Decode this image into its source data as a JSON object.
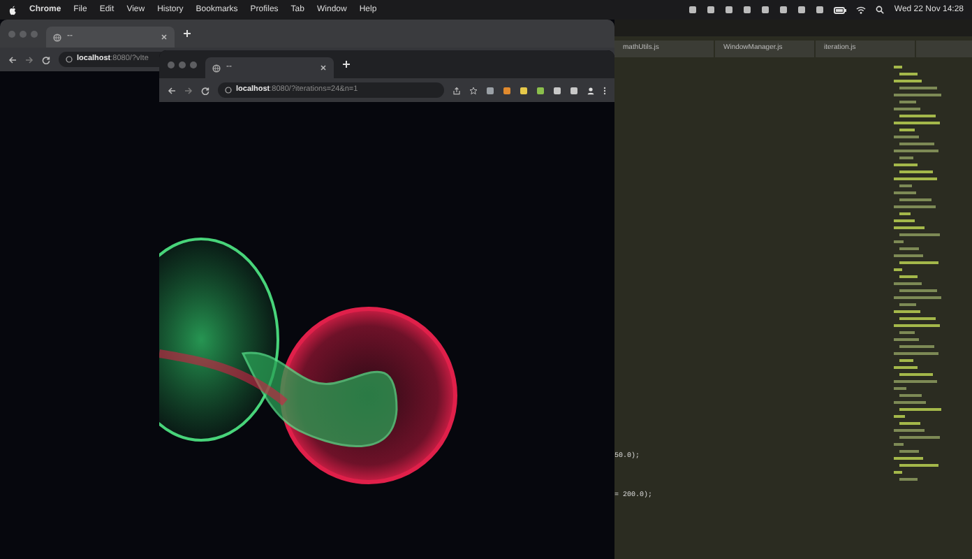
{
  "menu_bar": {
    "app": "Chrome",
    "menus": [
      "File",
      "Edit",
      "View",
      "History",
      "Bookmarks",
      "Profiles",
      "Tab",
      "Window",
      "Help"
    ],
    "clock": "Wed 22 Nov 14:28"
  },
  "back_browser": {
    "tabs": [
      {
        "title": "--",
        "selected": true
      }
    ],
    "url_host": "localhost",
    "url_rest": ":8080/?vIte"
  },
  "front_browser": {
    "tabs": [
      {
        "title": "--",
        "selected": true
      }
    ],
    "url_host": "localhost",
    "url_rest": ":8080/?iterations=24&n=1"
  },
  "editor": {
    "tabs": [
      {
        "title": "mathUtils.js",
        "selected": false
      },
      {
        "title": "WindowManager.js",
        "selected": false
      },
      {
        "title": "iteration.js",
        "selected": false
      }
    ],
    "code_lines": [
      "50.0);",
      "= 200.0);"
    ]
  }
}
